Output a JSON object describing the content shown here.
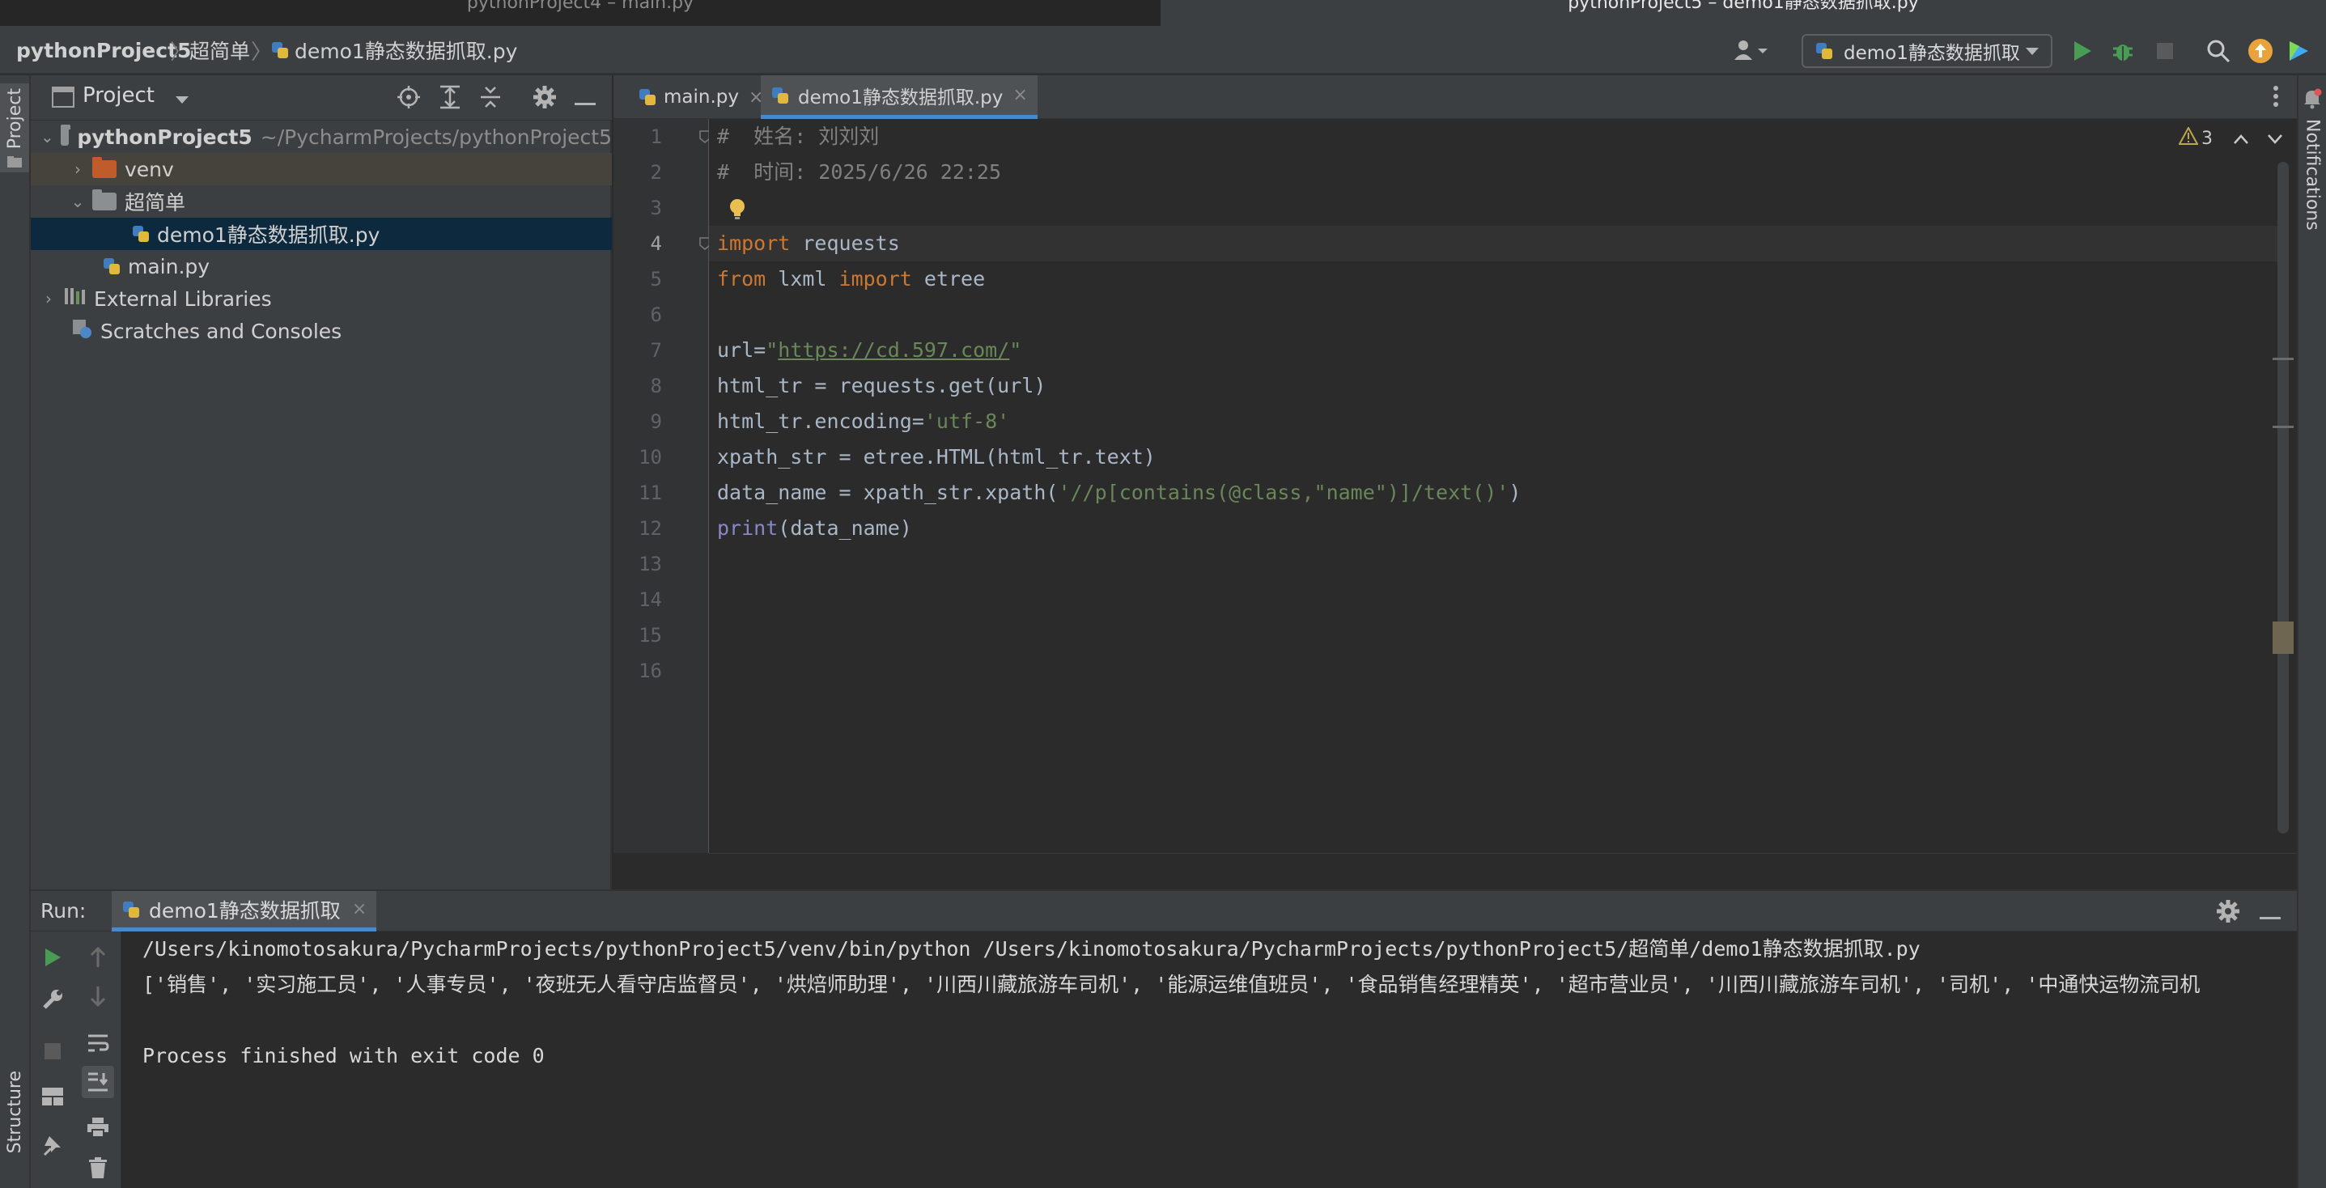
{
  "window_tabs": [
    "pythonProject4 – main.py",
    "pythonProject5 – demo1静态数据抓取.py"
  ],
  "breadcrumb": {
    "project": "pythonProject5",
    "folder": "超简单",
    "file": "demo1静态数据抓取.py"
  },
  "toolbar": {
    "run_config": "demo1静态数据抓取"
  },
  "left_stripe": {
    "project_label": "Project",
    "structure_label": "Structure"
  },
  "right_stripe": {
    "notifications_label": "Notifications"
  },
  "project_panel": {
    "title": "Project",
    "tree": [
      {
        "label": "pythonProject5",
        "hint": "~/PycharmProjects/pythonProject5"
      },
      {
        "label": "venv"
      },
      {
        "label": "超简单"
      },
      {
        "label": "demo1静态数据抓取.py"
      },
      {
        "label": "main.py"
      },
      {
        "label": "External Libraries"
      },
      {
        "label": "Scratches and Consoles"
      }
    ]
  },
  "editor": {
    "tabs": [
      {
        "label": "main.py"
      },
      {
        "label": "demo1静态数据抓取.py"
      }
    ],
    "warnings_count": "3",
    "line_numbers": [
      "1",
      "2",
      "3",
      "4",
      "5",
      "6",
      "7",
      "8",
      "9",
      "10",
      "11",
      "12",
      "13",
      "14",
      "15",
      "16"
    ],
    "code": {
      "l1_hash": "#",
      "l1_text": "  姓名: 刘刘刘",
      "l2_hash": "#",
      "l2_text": "  时间: 2025/6/26 22:25",
      "l4_kw": "import",
      "l4_rest": " requests",
      "l5_kw1": "from",
      "l5_mid": " lxml ",
      "l5_kw2": "import",
      "l5_rest": " etree",
      "l7_a": "url=",
      "l7_q1": "\"",
      "l7_url": "https://cd.597.com/",
      "l7_q2": "\"",
      "l8": "html_tr = requests.get(url)",
      "l9_a": "html_tr.encoding=",
      "l9_str": "'utf-8'",
      "l10": "xpath_str = etree.HTML(html_tr.text)",
      "l11_a": "data_name = xpath_str.xpath(",
      "l11_str": "'//p[contains(@class,\"name\")]/text()'",
      "l11_b": ")",
      "l12_bi": "print",
      "l12_rest": "(data_name)"
    }
  },
  "run_panel": {
    "label": "Run:",
    "tab": "demo1静态数据抓取",
    "output": [
      "/Users/kinomotosakura/PycharmProjects/pythonProject5/venv/bin/python /Users/kinomotosakura/PycharmProjects/pythonProject5/超简单/demo1静态数据抓取.py",
      "['销售', '实习施工员', '人事专员', '夜班无人看守店监督员', '烘焙师助理', '川西川藏旅游车司机', '能源运维值班员', '食品销售经理精英', '超市营业员', '川西川藏旅游车司机', '司机', '中通快运物流司机",
      "",
      "Process finished with exit code 0"
    ]
  },
  "colors": {
    "accent": "#4a88c7",
    "keyword": "#cc7832",
    "string": "#6a8759",
    "comment": "#808080",
    "builtin": "#8888c6",
    "run_green": "#499c54"
  }
}
